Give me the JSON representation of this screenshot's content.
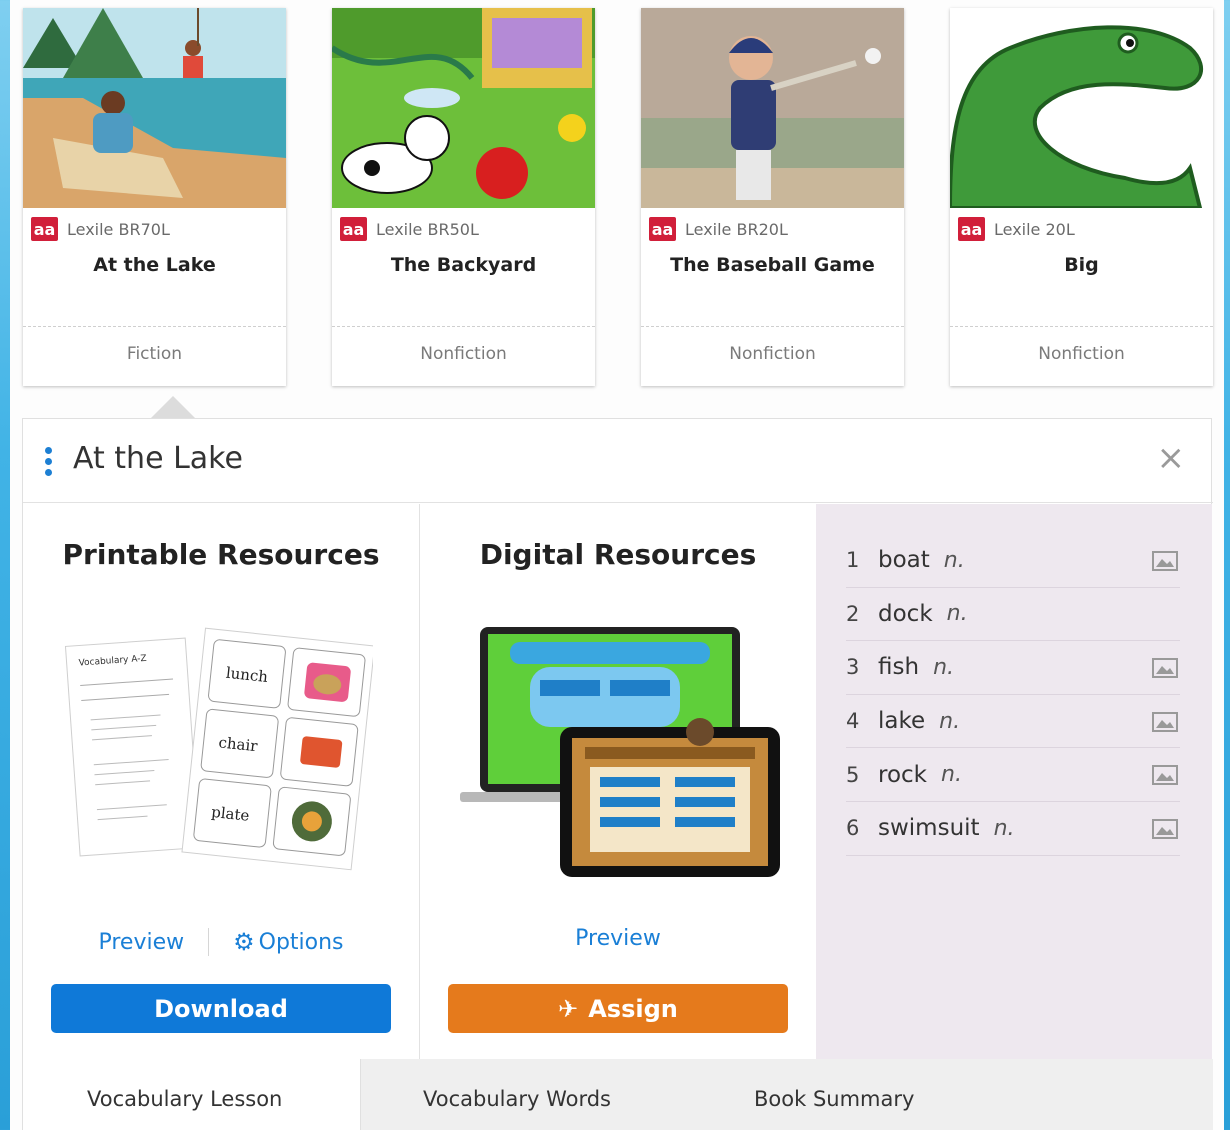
{
  "books": [
    {
      "lexile": "Lexile BR70L",
      "title": "At the Lake",
      "genre": "Fiction"
    },
    {
      "lexile": "Lexile BR50L",
      "title": "The Backyard",
      "genre": "Nonfiction"
    },
    {
      "lexile": "Lexile BR20L",
      "title": "The Baseball Game",
      "genre": "Nonfiction"
    },
    {
      "lexile": "Lexile 20L",
      "title": "Big",
      "genre": "Nonfiction"
    }
  ],
  "badge": "aa",
  "panel": {
    "title": "At the Lake",
    "close": "×"
  },
  "printable": {
    "heading": "Printable Resources",
    "preview": "Preview",
    "options": "Options",
    "download": "Download",
    "card_words": [
      "lunch",
      "chair",
      "plate"
    ],
    "worksheet_title": "Vocabulary A-Z"
  },
  "digital": {
    "heading": "Digital Resources",
    "preview": "Preview",
    "assign": "Assign"
  },
  "vocab": [
    {
      "num": "1",
      "word": "boat",
      "pos": "n.",
      "has_image": true
    },
    {
      "num": "2",
      "word": "dock",
      "pos": "n.",
      "has_image": false
    },
    {
      "num": "3",
      "word": "fish",
      "pos": "n.",
      "has_image": true
    },
    {
      "num": "4",
      "word": "lake",
      "pos": "n.",
      "has_image": true
    },
    {
      "num": "5",
      "word": "rock",
      "pos": "n.",
      "has_image": true
    },
    {
      "num": "6",
      "word": "swimsuit",
      "pos": "n.",
      "has_image": true
    }
  ],
  "tabs": [
    "Vocabulary Lesson",
    "Vocabulary Words",
    "Book Summary"
  ],
  "colors": {
    "badge": "#d11f3a",
    "link": "#1a7fd6",
    "download": "#0f79d8",
    "assign": "#e57a1c",
    "vocab_bg": "#eee8ef"
  }
}
